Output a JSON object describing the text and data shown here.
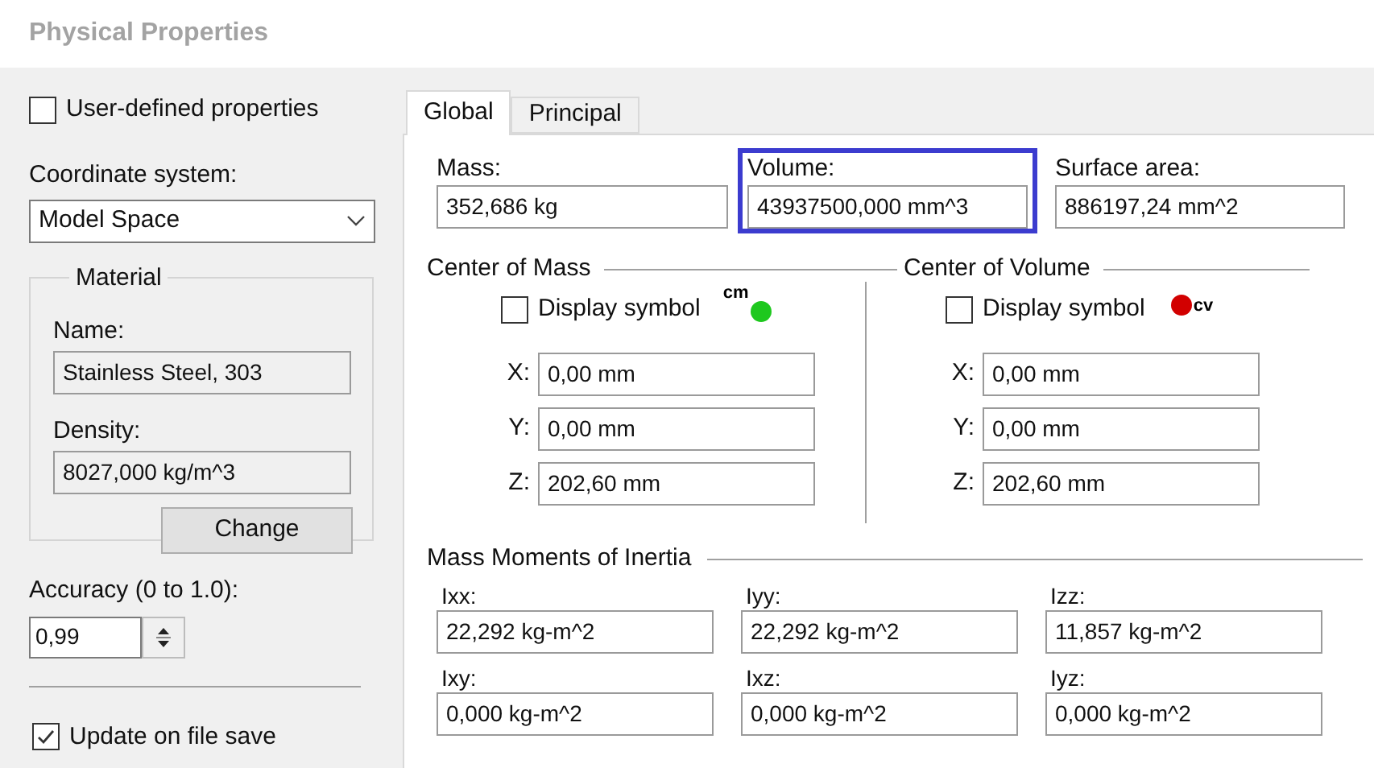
{
  "title": "Physical Properties",
  "left": {
    "user_defined": {
      "label": "User-defined properties",
      "checked": false
    },
    "coordinate_system": {
      "label": "Coordinate system:",
      "value": "Model Space"
    },
    "material": {
      "title": "Material",
      "name_label": "Name:",
      "name": "Stainless Steel, 303",
      "density_label": "Density:",
      "density": "8027,000 kg/m^3",
      "button": "Change"
    },
    "accuracy": {
      "label": "Accuracy (0 to 1.0):",
      "value": "0,99"
    },
    "update_on_save": {
      "label": "Update on file save",
      "checked": true
    }
  },
  "tabs": [
    {
      "label": "Global",
      "selected": true
    },
    {
      "label": "Principal",
      "selected": false
    }
  ],
  "global": {
    "fields": [
      {
        "label": "Mass:",
        "value": "352,686 kg",
        "highlighted": false
      },
      {
        "label": "Volume:",
        "value": "43937500,000 mm^3",
        "highlighted": true
      },
      {
        "label": "Surface area:",
        "value": "886197,24 mm^2",
        "highlighted": false
      }
    ],
    "centers": [
      {
        "title": "Center of Mass",
        "display_symbol": {
          "label": "Display symbol",
          "checked": false
        },
        "symbol": "cm",
        "kind": "leading",
        "color": "#1ec81e",
        "coords": [
          {
            "axis": "X:",
            "value": "0,00 mm"
          },
          {
            "axis": "Y:",
            "value": "0,00 mm"
          },
          {
            "axis": "Z:",
            "value": "202,60 mm"
          }
        ]
      },
      {
        "title": "Center of Volume",
        "display_symbol": {
          "label": "Display symbol",
          "checked": false
        },
        "symbol": "cv",
        "kind": "trailing",
        "color": "#d20000",
        "coords": [
          {
            "axis": "X:",
            "value": "0,00 mm"
          },
          {
            "axis": "Y:",
            "value": "0,00 mm"
          },
          {
            "axis": "Z:",
            "value": "202,60 mm"
          }
        ]
      }
    ],
    "inertia": {
      "title": "Mass Moments of Inertia",
      "items": [
        {
          "label": "Ixx:",
          "value": "22,292 kg-m^2"
        },
        {
          "label": "Iyy:",
          "value": "22,292 kg-m^2"
        },
        {
          "label": "Izz:",
          "value": "11,857 kg-m^2"
        },
        {
          "label": "Ixy:",
          "value": "0,000 kg-m^2"
        },
        {
          "label": "Ixz:",
          "value": "0,000 kg-m^2"
        },
        {
          "label": "Iyz:",
          "value": "0,000 kg-m^2"
        }
      ]
    }
  }
}
